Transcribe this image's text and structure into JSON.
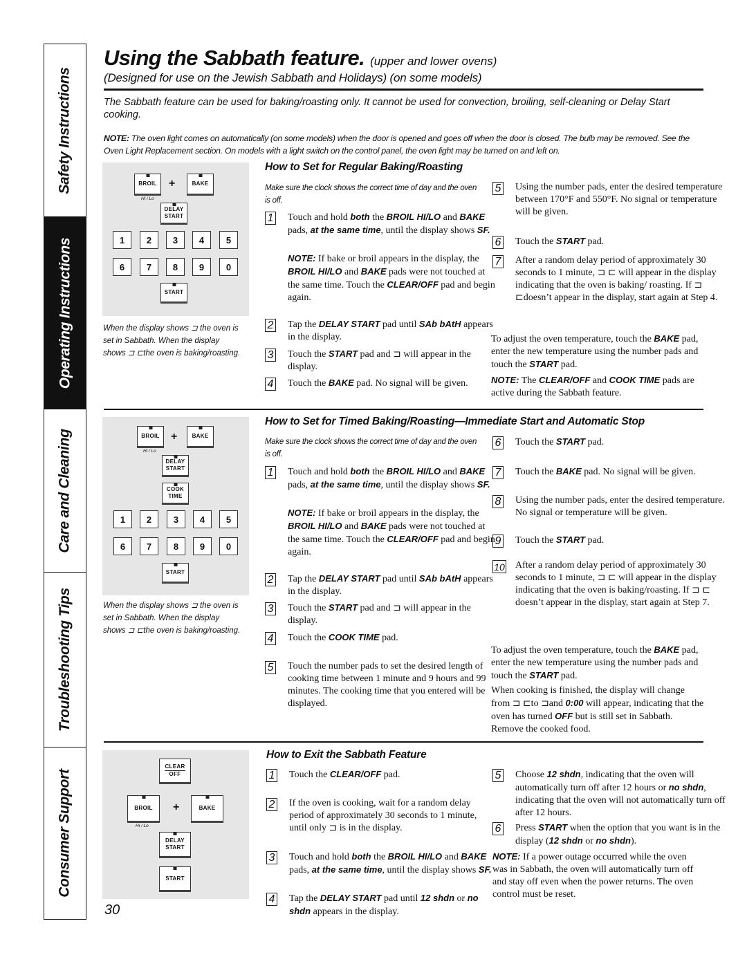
{
  "side_tabs": [
    {
      "label": "Safety Instructions",
      "active": false
    },
    {
      "label": "Operating Instructions",
      "active": true
    },
    {
      "label": "Care and Cleaning",
      "active": false
    },
    {
      "label": "Troubleshooting Tips",
      "active": false
    },
    {
      "label": "Consumer Support",
      "active": false
    }
  ],
  "header": {
    "title": "Using the Sabbath feature.",
    "title_suffix": "(upper and lower ovens)",
    "subtitle": "(Designed for use on the Jewish Sabbath and Holidays)  (on some models)",
    "intro": "The Sabbath feature can be used for baking/roasting only. It cannot be used for convection, broiling, self-cleaning or Delay Start cooking.",
    "note_label": "NOTE:",
    "note_text": " The oven light comes on automatically (on some models) when the door is opened and goes off when the door is closed. The bulb may be removed. See the Oven Light Replacement section. On models with a light switch on the control panel, the oven light may be turned on and left on."
  },
  "panel_labels": {
    "broil": "BROIL",
    "bake": "BAKE",
    "hilo": "Hi / Lo",
    "plus": "+",
    "delay": "DELAY",
    "start_word": "START",
    "cook": "COOK",
    "time": "TIME",
    "clear": "CLEAR",
    "off": "OFF",
    "numbers": [
      "1",
      "2",
      "3",
      "4",
      "5",
      "6",
      "7",
      "8",
      "9",
      "0"
    ]
  },
  "caption": "When the display shows ⊐ the oven is set in Sabbath. When the display shows ⊐ ⊏the oven is baking/roasting.",
  "sections": {
    "regular": {
      "heading": "How to Set for Regular Baking/Roasting",
      "pre": "Make sure the clock shows the correct time of day and the oven is off.",
      "adjust": "To adjust the oven temperature, touch the <b>BAKE</b> pad, enter the new temperature using the number pads and touch the <b>START</b> pad.",
      "note": "<b>NOTE:</b> The <b>CLEAR/OFF</b> and <b>COOK TIME</b> pads are active during the Sabbath feature."
    },
    "timed": {
      "heading": "How to Set for Timed Baking/Roasting—Immediate Start and Automatic Stop",
      "pre": "Make sure the clock shows the correct time of day and the oven is off.",
      "adjust": "To adjust the oven temperature, touch the <b>BAKE</b> pad, enter the new temperature using the number pads and touch the <b>START</b> pad.",
      "finished": "When cooking is finished, the display will change from ⊐ ⊏to ⊐and <b>0:00</b> will appear, indicating that the oven has turned <b>OFF</b> but is still set in Sabbath. Remove the cooked food."
    },
    "exit": {
      "heading": "How to Exit the Sabbath Feature",
      "note": "<b>NOTE:</b> If a power outage occurred while the oven was in Sabbath, the oven will automatically turn off and stay off even when the power returns. The oven control must be reset."
    }
  },
  "steps": {
    "regular": [
      {
        "n": "1",
        "html": "Touch and hold <b>both</b> the <b>BROIL HI/LO</b> and <b>BAKE</b> pads, <b>at the same time</b>, until the display shows <b>SF.</b>"
      },
      {
        "n": "",
        "html": "<b>NOTE:</b> If bake or broil appears in the display, the <b>BROIL HI/LO</b> and <b>BAKE</b> pads were not touched at the same time. Touch the <b>CLEAR/OFF</b> pad and begin again."
      },
      {
        "n": "2",
        "html": "Tap the <b>DELAY START</b> pad until <b>SAb bAtH</b> appears in the display."
      },
      {
        "n": "3",
        "html": "Touch the <b>START</b> pad and ⊐ will appear in the display."
      },
      {
        "n": "4",
        "html": "Touch the <b>BAKE</b> pad. No signal will be given."
      },
      {
        "n": "5",
        "html": "Using the number pads, enter the desired temperature between 170°F and 550°F. No signal or temperature will be given."
      },
      {
        "n": "6",
        "html": "Touch the <b>START</b> pad."
      },
      {
        "n": "7",
        "html": "After a random delay period of approximately 30 seconds to 1 minute, ⊐ ⊏ will appear in the display indicating that the oven is baking/ roasting. If ⊐ ⊏doesn’t appear in the display, start again at Step 4."
      }
    ],
    "timed": [
      {
        "n": "1",
        "html": "Touch and hold <b>both</b> the <b>BROIL HI/LO</b> and <b>BAKE</b> pads, <b>at the same time</b>, until the display shows <b>SF.</b>"
      },
      {
        "n": "",
        "html": "<b>NOTE:</b> If bake or broil appears in the display, the <b>BROIL HI/LO</b> and  <b>BAKE</b> pads were not touched at the same time. Touch the <b>CLEAR/OFF</b> pad and begin again."
      },
      {
        "n": "2",
        "html": "Tap the <b>DELAY START</b> pad until <b>SAb bAtH</b> appears in the display."
      },
      {
        "n": "3",
        "html": "Touch the <b>START</b> pad and ⊐ will appear in the display."
      },
      {
        "n": "4",
        "html": "Touch the <b>COOK TIME</b> pad."
      },
      {
        "n": "5",
        "html": "Touch the number pads to set the desired length of cooking time between 1 minute and 9 hours and 99 minutes. The cooking time that you entered will be displayed."
      },
      {
        "n": "6",
        "html": "Touch the <b>START</b> pad."
      },
      {
        "n": "7",
        "html": "Touch the <b>BAKE</b> pad. No signal will be given."
      },
      {
        "n": "8",
        "html": "Using the number pads, enter the desired temperature. No signal or temperature will be given."
      },
      {
        "n": "9",
        "html": "Touch the <b>START</b> pad."
      },
      {
        "n": "10",
        "html": "After a random delay period of approximately 30 seconds to 1 minute, ⊐ ⊏ will appear in the display indicating that the oven is baking/roasting. If ⊐ ⊏ doesn’t appear in the display, start again at Step 7."
      }
    ],
    "exit": [
      {
        "n": "1",
        "html": "Touch the <b>CLEAR/OFF</b> pad."
      },
      {
        "n": "2",
        "html": "If the oven is cooking, wait for a random delay period of approximately 30 seconds to 1 minute, until only ⊐ is in the display."
      },
      {
        "n": "3",
        "html": "Touch and hold <b>both</b> the <b>BROIL HI/LO</b> and  <b>BAKE</b> pads, <b>at the same time</b>, until the display shows <b>SF.</b>"
      },
      {
        "n": "4",
        "html": "Tap the <b>DELAY START</b> pad until <b>12 shdn</b> or <b>no shdn</b> appears in the display."
      },
      {
        "n": "5",
        "html": "Choose <b>12 shdn</b>, indicating that the oven will automatically turn off after 12 hours or <b>no shdn</b>, indicating that the oven will not automatically turn off after 12 hours."
      },
      {
        "n": "6",
        "html": "Press <b>START</b> when the option that you want is in the display (<b>12 shdn</b> or <b>no shdn</b>)."
      }
    ]
  },
  "page_number": "30"
}
